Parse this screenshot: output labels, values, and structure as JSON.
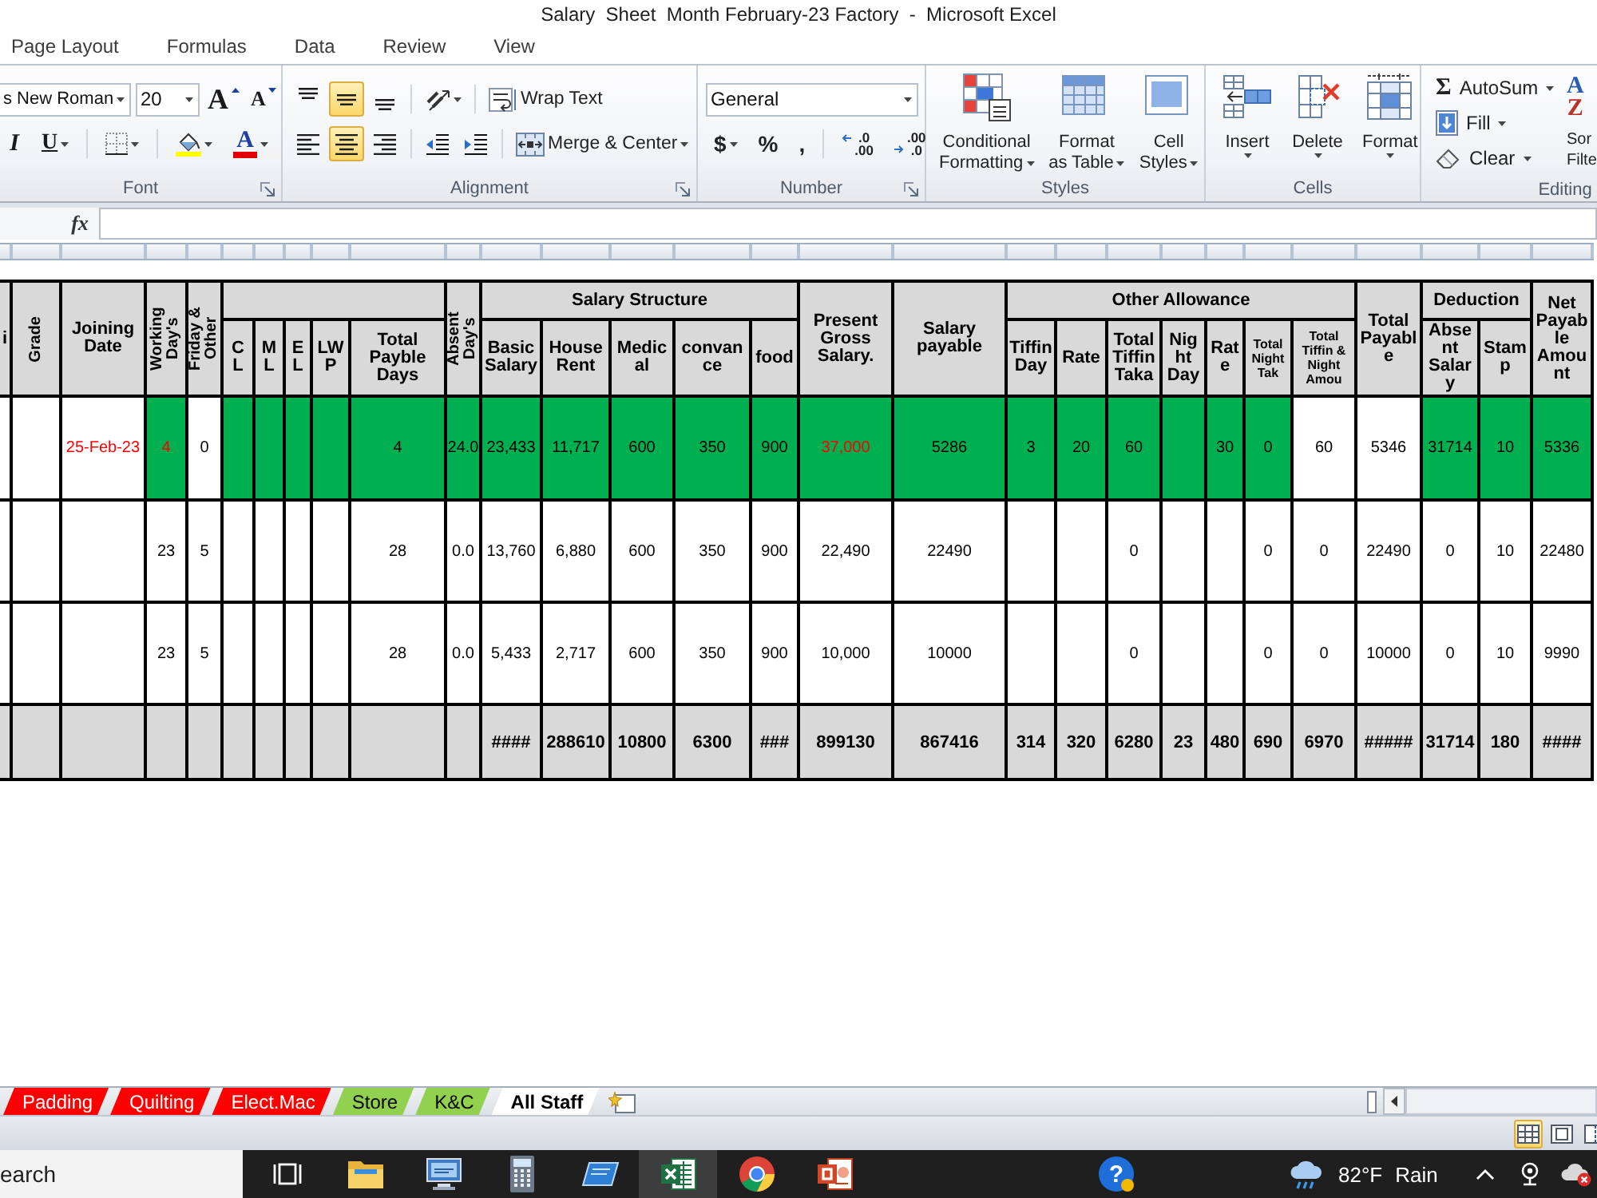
{
  "window": {
    "title": "Salary  Sheet  Month February-23 Factory  -  Microsoft Excel"
  },
  "ribbon_tabs": [
    {
      "label": "Page Layout",
      "selected": false
    },
    {
      "label": "Formulas",
      "selected": false
    },
    {
      "label": "Data",
      "selected": false
    },
    {
      "label": "Review",
      "selected": false
    },
    {
      "label": "View",
      "selected": false
    }
  ],
  "font_group": {
    "label": "Font",
    "font_name": "s New Roman",
    "font_size": "20",
    "grow_font": "A",
    "shrink_font": "A",
    "italic": "I",
    "underline": "U",
    "font_color": "A"
  },
  "alignment_group": {
    "label": "Alignment",
    "vertical": [
      {
        "kind": "top",
        "selected": false
      },
      {
        "kind": "middle",
        "selected": true
      },
      {
        "kind": "bottom",
        "selected": false
      }
    ],
    "horizontal": [
      {
        "kind": "left",
        "selected": false
      },
      {
        "kind": "center",
        "selected": true
      },
      {
        "kind": "right",
        "selected": false
      }
    ],
    "wrap_text": "Wrap Text",
    "merge_center": "Merge & Center"
  },
  "number_group": {
    "label": "Number",
    "format": "General",
    "currency": "$",
    "percent": "%",
    "comma": ",",
    "decimals": [
      {
        "kind": "increase",
        "top": ".0",
        "bottom": ".00"
      },
      {
        "kind": "decrease",
        "top": ".00",
        "bottom": ".0"
      }
    ]
  },
  "styles_group": {
    "label": "Styles",
    "buttons": [
      {
        "kind": "conditional",
        "lines": [
          "Conditional",
          "Formatting"
        ]
      },
      {
        "kind": "table",
        "lines": [
          "Format",
          "as Table"
        ]
      },
      {
        "kind": "cellstyles",
        "lines": [
          "Cell",
          "Styles"
        ]
      }
    ]
  },
  "cells_group": {
    "label": "Cells",
    "buttons": [
      {
        "kind": "insert",
        "label": "Insert"
      },
      {
        "kind": "delete",
        "label": "Delete"
      },
      {
        "kind": "format",
        "label": "Format"
      }
    ]
  },
  "editing_group": {
    "label": "Editing",
    "autosum": {
      "symbol": "Σ",
      "label": "AutoSum"
    },
    "fill": "Fill",
    "clear": "Clear",
    "sort": {
      "letters": [
        "A",
        "Z"
      ],
      "lines": [
        "Sor",
        "Filte"
      ]
    }
  },
  "formula_bar": {
    "function_label": "fx"
  },
  "table": {
    "header": [
      {
        "kind": "horizontal",
        "label": "i"
      },
      {
        "kind": "vertical",
        "label": "Grade"
      },
      {
        "kind": "horizontal",
        "label": "Joining Date"
      },
      {
        "kind": "vertical",
        "label": "Working Day's"
      },
      {
        "kind": "vertical",
        "label": "Friday & Other"
      },
      {
        "kind": "group",
        "columns": [
          {
            "kind": "horizontal",
            "label": "C L"
          },
          {
            "kind": "horizontal",
            "label": "M L"
          },
          {
            "kind": "horizontal",
            "label": "E L"
          },
          {
            "kind": "horizontal",
            "label": "LWP"
          },
          {
            "kind": "horizontal",
            "label": "Total Payble Days"
          }
        ]
      },
      {
        "kind": "vertical",
        "label": "Absent Day's"
      },
      {
        "kind": "group",
        "label": "Salary Structure",
        "columns": [
          {
            "kind": "horizontal",
            "label": "Basic Salary"
          },
          {
            "kind": "horizontal",
            "label": "House Rent"
          },
          {
            "kind": "horizontal",
            "label": "Medical"
          },
          {
            "kind": "horizontal",
            "label": "convance"
          },
          {
            "kind": "horizontal",
            "label": "food"
          }
        ]
      },
      {
        "kind": "horizontal",
        "label": "Present Gross Salary."
      },
      {
        "kind": "horizontal",
        "label": "Salary payable"
      },
      {
        "kind": "group",
        "label": "Other Allowance",
        "columns": [
          {
            "kind": "horizontal",
            "label": "Tiffin Day"
          },
          {
            "kind": "horizontal",
            "label": "Rate"
          },
          {
            "kind": "horizontal",
            "label": "Total Tiffin Taka"
          },
          {
            "kind": "horizontal",
            "label": "Night Day"
          },
          {
            "kind": "horizontal",
            "label": "Rate"
          },
          {
            "kind": "dense",
            "label": "Total Night Tak"
          },
          {
            "kind": "dense",
            "label": "Total Tiffin & Night Amou"
          }
        ]
      },
      {
        "kind": "horizontal",
        "label": "Total Payable"
      },
      {
        "kind": "group",
        "label": "Deduction",
        "columns": [
          {
            "kind": "horizontal",
            "label": "Absent Salary"
          },
          {
            "kind": "horizontal",
            "label": "Stamp"
          }
        ]
      },
      {
        "kind": "horizontal",
        "label": "Net Payable Amount"
      }
    ],
    "rows": [
      {
        "kind": "data",
        "cells": [
          {
            "highlighted": false
          },
          {
            "highlighted": false
          },
          {
            "text": "25-Feb-23",
            "highlighted": false,
            "flagged": true
          },
          {
            "text": "4",
            "highlighted": true,
            "flagged": true
          },
          {
            "text": "0",
            "highlighted": false,
            "flagged": false
          },
          {
            "highlighted": true
          },
          {
            "highlighted": true
          },
          {
            "highlighted": true
          },
          {
            "highlighted": true
          },
          {
            "text": "4",
            "highlighted": true,
            "flagged": false
          },
          {
            "text": "24.0",
            "highlighted": true,
            "flagged": false
          },
          {
            "text": "23,433",
            "highlighted": true,
            "flagged": false
          },
          {
            "text": "11,717",
            "highlighted": true,
            "flagged": false
          },
          {
            "text": "600",
            "highlighted": true,
            "flagged": false
          },
          {
            "text": "350",
            "highlighted": true,
            "flagged": false
          },
          {
            "text": "900",
            "highlighted": true,
            "flagged": false
          },
          {
            "text": "37,000",
            "highlighted": true,
            "flagged": true
          },
          {
            "text": "5286",
            "highlighted": true,
            "flagged": false
          },
          {
            "text": "3",
            "highlighted": true,
            "flagged": false
          },
          {
            "text": "20",
            "highlighted": true,
            "flagged": false
          },
          {
            "text": "60",
            "highlighted": true,
            "flagged": false
          },
          {
            "highlighted": true
          },
          {
            "text": "30",
            "highlighted": true,
            "flagged": false
          },
          {
            "text": "0",
            "highlighted": true,
            "flagged": false
          },
          {
            "text": "60",
            "highlighted": false,
            "flagged": false
          },
          {
            "text": "5346",
            "highlighted": false,
            "flagged": false
          },
          {
            "text": "31714",
            "highlighted": true,
            "flagged": false
          },
          {
            "text": "10",
            "highlighted": true,
            "flagged": false
          },
          {
            "text": "5336",
            "highlighted": true,
            "flagged": false
          }
        ]
      },
      {
        "kind": "data",
        "cells": [
          {
            "highlighted": false
          },
          {
            "highlighted": false
          },
          {
            "highlighted": false
          },
          {
            "text": "23",
            "highlighted": false,
            "flagged": false
          },
          {
            "text": "5",
            "highlighted": false,
            "flagged": false
          },
          {
            "highlighted": false
          },
          {
            "highlighted": false
          },
          {
            "highlighted": false
          },
          {
            "highlighted": false
          },
          {
            "text": "28",
            "highlighted": false,
            "flagged": false
          },
          {
            "text": "0.0",
            "highlighted": false,
            "flagged": false
          },
          {
            "text": "13,760",
            "highlighted": false,
            "flagged": false
          },
          {
            "text": "6,880",
            "highlighted": false,
            "flagged": false
          },
          {
            "text": "600",
            "highlighted": false,
            "flagged": false
          },
          {
            "text": "350",
            "highlighted": false,
            "flagged": false
          },
          {
            "text": "900",
            "highlighted": false,
            "flagged": false
          },
          {
            "text": "22,490",
            "highlighted": false,
            "flagged": false
          },
          {
            "text": "22490",
            "highlighted": false,
            "flagged": false
          },
          {
            "highlighted": false
          },
          {
            "highlighted": false
          },
          {
            "text": "0",
            "highlighted": false,
            "flagged": false
          },
          {
            "highlighted": false
          },
          {
            "highlighted": false
          },
          {
            "text": "0",
            "highlighted": false,
            "flagged": false
          },
          {
            "text": "0",
            "highlighted": false,
            "flagged": false
          },
          {
            "text": "22490",
            "highlighted": false,
            "flagged": false
          },
          {
            "text": "0",
            "highlighted": false,
            "flagged": false
          },
          {
            "text": "10",
            "highlighted": false,
            "flagged": false
          },
          {
            "text": "22480",
            "highlighted": false,
            "flagged": false
          }
        ]
      },
      {
        "kind": "data",
        "cells": [
          {
            "highlighted": false
          },
          {
            "highlighted": false
          },
          {
            "highlighted": false
          },
          {
            "text": "23",
            "highlighted": false,
            "flagged": false
          },
          {
            "text": "5",
            "highlighted": false,
            "flagged": false
          },
          {
            "highlighted": false
          },
          {
            "highlighted": false
          },
          {
            "highlighted": false
          },
          {
            "highlighted": false
          },
          {
            "text": "28",
            "highlighted": false,
            "flagged": false
          },
          {
            "text": "0.0",
            "highlighted": false,
            "flagged": false
          },
          {
            "text": "5,433",
            "highlighted": false,
            "flagged": false
          },
          {
            "text": "2,717",
            "highlighted": false,
            "flagged": false
          },
          {
            "text": "600",
            "highlighted": false,
            "flagged": false
          },
          {
            "text": "350",
            "highlighted": false,
            "flagged": false
          },
          {
            "text": "900",
            "highlighted": false,
            "flagged": false
          },
          {
            "text": "10,000",
            "highlighted": false,
            "flagged": false
          },
          {
            "text": "10000",
            "highlighted": false,
            "flagged": false
          },
          {
            "highlighted": false
          },
          {
            "highlighted": false
          },
          {
            "text": "0",
            "highlighted": false,
            "flagged": false
          },
          {
            "highlighted": false
          },
          {
            "highlighted": false
          },
          {
            "text": "0",
            "highlighted": false,
            "flagged": false
          },
          {
            "text": "0",
            "highlighted": false,
            "flagged": false
          },
          {
            "text": "10000",
            "highlighted": false,
            "flagged": false
          },
          {
            "text": "0",
            "highlighted": false,
            "flagged": false
          },
          {
            "text": "10",
            "highlighted": false,
            "flagged": false
          },
          {
            "text": "9990",
            "highlighted": false,
            "flagged": false
          }
        ]
      },
      {
        "kind": "total",
        "cells": [
          {},
          {},
          {},
          {},
          {},
          {},
          {},
          {},
          {},
          {},
          {},
          {
            "text": "####"
          },
          {
            "text": "288610"
          },
          {
            "text": "10800"
          },
          {
            "text": "6300"
          },
          {
            "text": "###"
          },
          {
            "text": "899130"
          },
          {
            "text": "867416"
          },
          {
            "text": "314"
          },
          {
            "text": "320"
          },
          {
            "text": "6280"
          },
          {
            "text": "23"
          },
          {
            "text": "480"
          },
          {
            "text": "690"
          },
          {
            "text": "6970"
          },
          {
            "text": "#####"
          },
          {
            "text": "31714"
          },
          {
            "text": "180"
          },
          {
            "text": "####"
          }
        ]
      }
    ]
  },
  "sheet_tabs": [
    {
      "label": "Padding",
      "color": "#ff0000",
      "selected": false
    },
    {
      "label": "Quilting",
      "color": "#ff0000",
      "selected": false
    },
    {
      "label": "Elect.Mac",
      "color": "#ff0000",
      "selected": false
    },
    {
      "label": "Store",
      "color": "#92d050",
      "selected": false
    },
    {
      "label": "K&C",
      "color": "#92d050",
      "selected": false
    },
    {
      "label": "All Staff",
      "selected": true
    }
  ],
  "status_bar": {
    "views": [
      {
        "kind": "normal",
        "selected": true
      },
      {
        "kind": "page_layout",
        "selected": false
      },
      {
        "kind": "page_break",
        "selected": false
      }
    ]
  },
  "taskbar": {
    "search": {
      "placeholder": "earch"
    },
    "apps": [
      {
        "kind": "task_view",
        "selected": false
      },
      {
        "kind": "files",
        "selected": false
      },
      {
        "kind": "remote",
        "selected": false
      },
      {
        "kind": "calculator",
        "selected": false
      },
      {
        "kind": "tablet",
        "selected": false
      },
      {
        "kind": "spreadsheet",
        "selected": true
      },
      {
        "kind": "browser",
        "selected": false
      },
      {
        "kind": "presentation",
        "selected": false
      }
    ],
    "help": "?",
    "weather": {
      "temperature": "82°F",
      "condition": "Rain"
    }
  }
}
